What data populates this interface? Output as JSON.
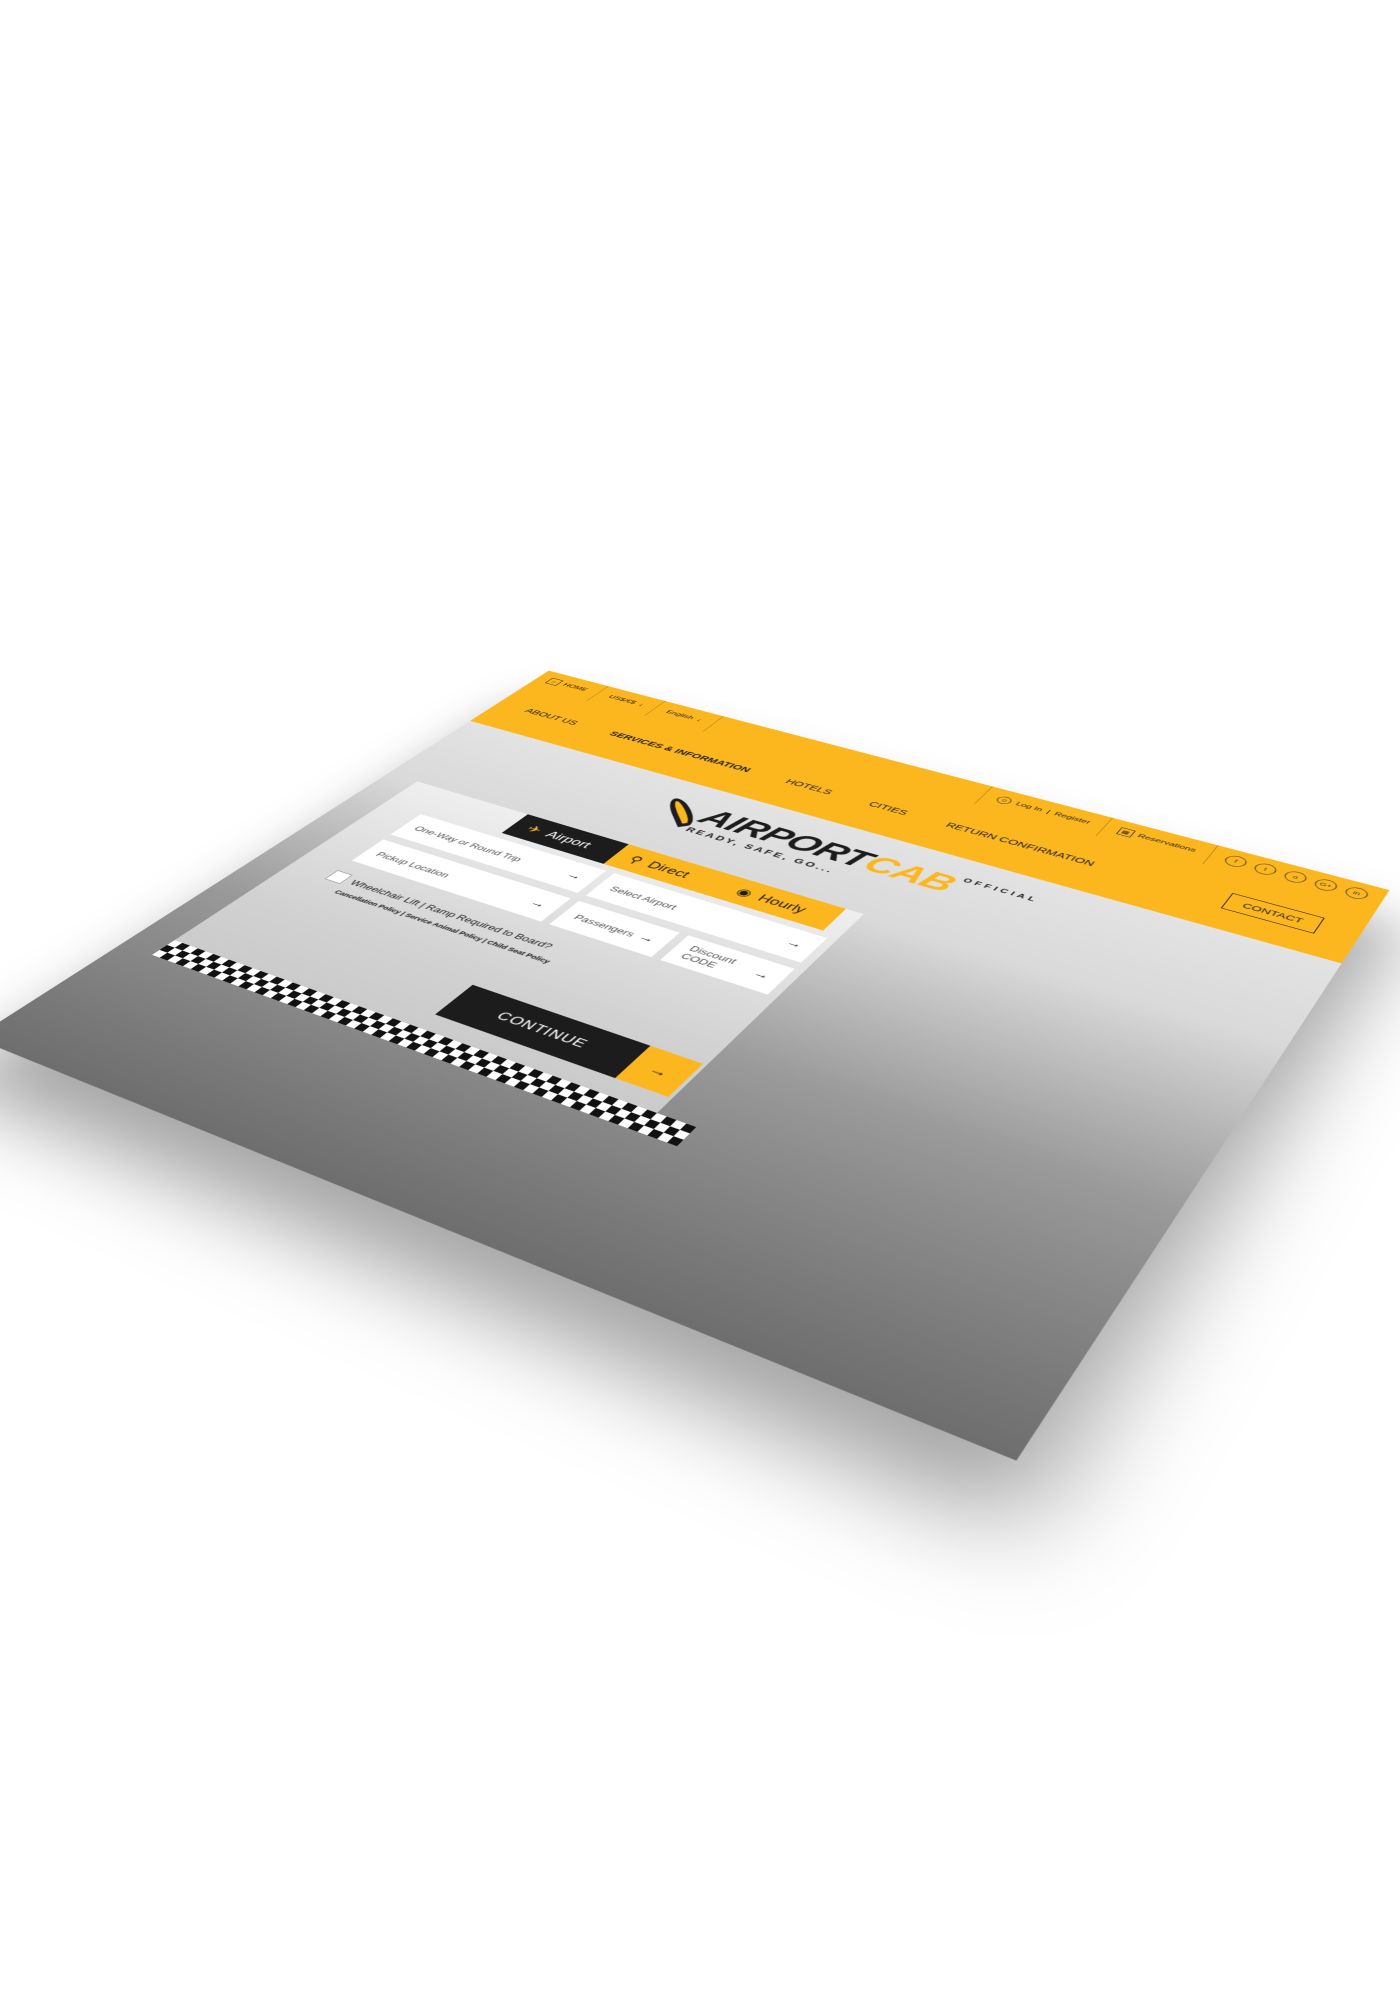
{
  "topbar": {
    "home": "HOME",
    "currency": "US$/€$",
    "language": "English",
    "login": "Log In",
    "register": "Register",
    "reservations": "Reservations",
    "social_icons": [
      "facebook-icon",
      "twitter-icon",
      "instagram-icon",
      "google-plus-icon",
      "linkedin-icon"
    ],
    "social_glyphs": [
      "f",
      "t",
      "o",
      "G+",
      "in"
    ]
  },
  "nav": {
    "items": [
      "ABOUT US",
      "SERVICES & INFORMATION",
      "HOTELS",
      "CITIES",
      "RETURN CONFIRMATION"
    ],
    "contact": "CONTACT"
  },
  "logo": {
    "word1": "AIRPORT",
    "word2": "CAB",
    "official": "OFFICIAL",
    "tagline": "READY, SAFE, GO..."
  },
  "booking": {
    "tabs": [
      "Airport",
      "Direct",
      "Hourly"
    ],
    "trip_type": "One-Way or Round Trip",
    "pickup": "Pickup Location",
    "airport": "Select Airport",
    "passengers": "Passengers",
    "discount": "Discount CODE",
    "continue": "CONTINUE",
    "wheelchair": "Wheelchair Lift | Ramp Required to Board?",
    "policy": "Cancellation Policy | Service Animal Policy | Child Seat Policy"
  },
  "colors": {
    "accent": "#FDB71E",
    "dark": "#1c1c1c"
  }
}
